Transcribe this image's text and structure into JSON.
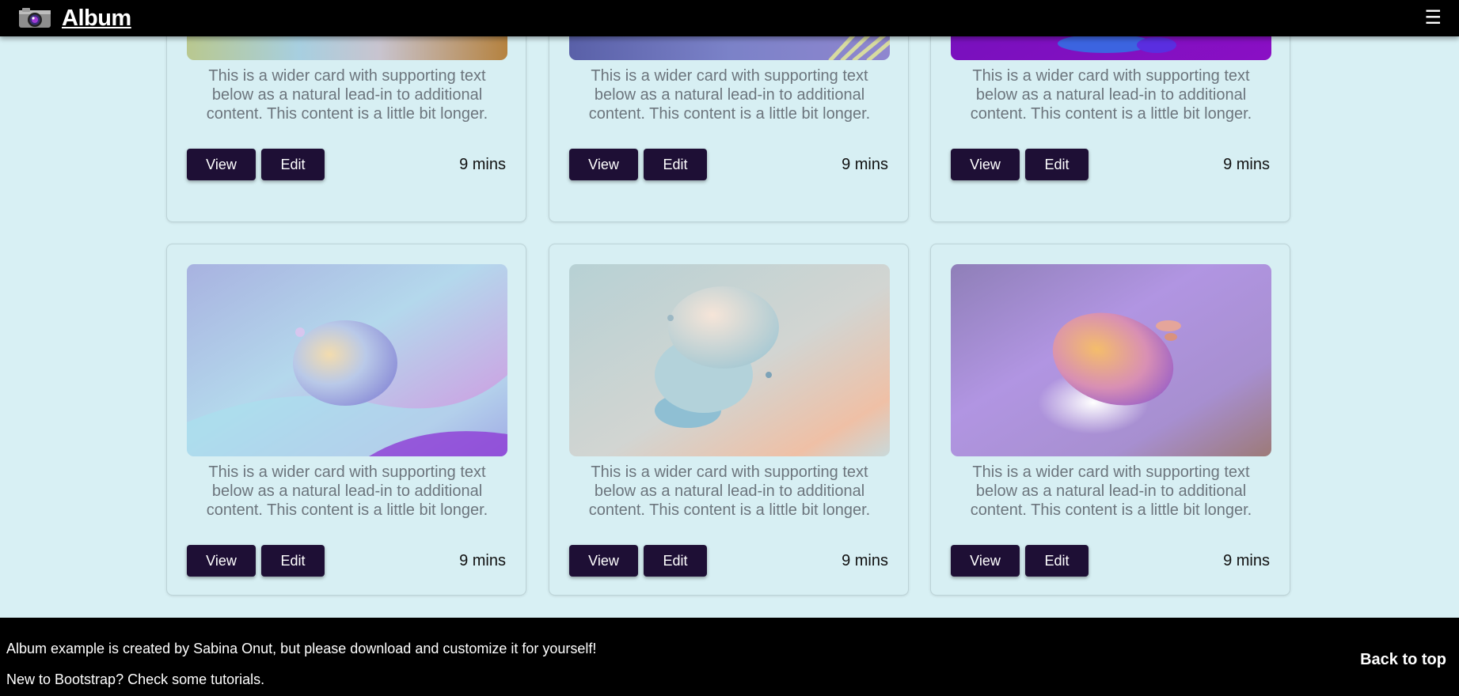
{
  "navbar": {
    "brand_title": "Album",
    "menu_glyph": "☰",
    "brand_icon": "camera-icon",
    "menu_icon": "hamburger-menu-icon"
  },
  "cards": [
    {
      "text": "This is a wider card with supporting text below as a natural lead-in to additional content. This content is a little bit longer.",
      "view_label": "View",
      "edit_label": "Edit",
      "time": "9 mins"
    },
    {
      "text": "This is a wider card with supporting text below as a natural lead-in to additional content. This content is a little bit longer.",
      "view_label": "View",
      "edit_label": "Edit",
      "time": "9 mins"
    },
    {
      "text": "This is a wider card with supporting text below as a natural lead-in to additional content. This content is a little bit longer.",
      "view_label": "View",
      "edit_label": "Edit",
      "time": "9 mins"
    },
    {
      "text": "This is a wider card with supporting text below as a natural lead-in to additional content. This content is a little bit longer.",
      "view_label": "View",
      "edit_label": "Edit",
      "time": "9 mins"
    },
    {
      "text": "This is a wider card with supporting text below as a natural lead-in to additional content. This content is a little bit longer.",
      "view_label": "View",
      "edit_label": "Edit",
      "time": "9 mins"
    },
    {
      "text": "This is a wider card with supporting text below as a natural lead-in to additional content. This content is a little bit longer.",
      "view_label": "View",
      "edit_label": "Edit",
      "time": "9 mins"
    }
  ],
  "footer": {
    "line1": "Album example is created by Sabina Onut, but please download and customize it for yourself!",
    "line2": "New to Bootstrap? Check some tutorials.",
    "back_to_top": "Back to top"
  },
  "colors": {
    "page_background": "#d8f0f4",
    "card_background": "#d7eff3",
    "button_background": "#1e0f35",
    "navbar_background": "#000000",
    "footer_background": "#000000",
    "card_text": "#6c757d"
  }
}
